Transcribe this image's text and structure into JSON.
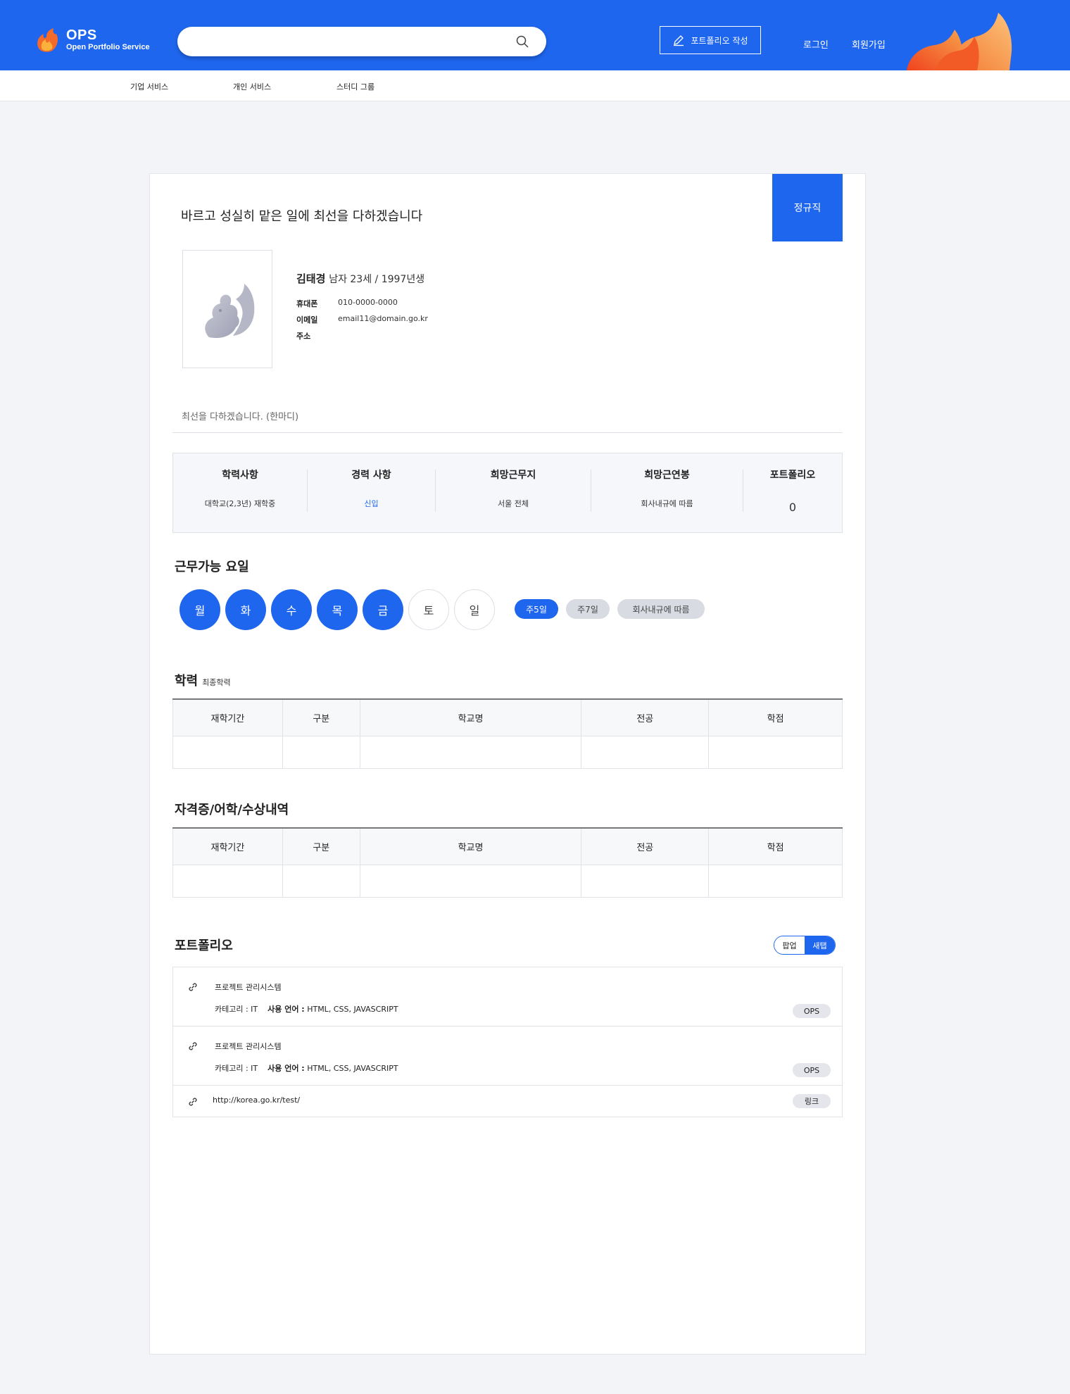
{
  "header": {
    "logo_title": "OPS",
    "logo_subtitle": "Open Portfolio Service",
    "search_placeholder": "",
    "write_button": "포트폴리오 작성",
    "login": "로그인",
    "signup": "회원가입",
    "brand_color": "#1f66ef"
  },
  "subnav": [
    "기업 서비스",
    "개인 서비스",
    "스터디 그룹"
  ],
  "profile": {
    "headline": "바르고 성실히 맡은 일에 최선을 다하겠습니다",
    "employment_type": "정규직",
    "name": "김태경",
    "meta": "남자 23세 / 1997년생",
    "phone_label": "휴대폰",
    "phone": "010-0000-0000",
    "email_label": "이메일",
    "email": "email11@domain.go.kr",
    "address_label": "주소",
    "address": "",
    "greeting": "최선을 다하겠습니다. (한마디)"
  },
  "summary": [
    {
      "title": "학력사항",
      "value": "대학교(2,3년) 재학중"
    },
    {
      "title": "경력 사항",
      "value": "신입"
    },
    {
      "title": "희망근무지",
      "value": "서울 전체"
    },
    {
      "title": "희망근연봉",
      "value": "회사내규에 따름"
    },
    {
      "title": "포트폴리오",
      "value": "0"
    }
  ],
  "workdays": {
    "title": "근무가능 요일",
    "days": [
      {
        "label": "월",
        "selected": true
      },
      {
        "label": "화",
        "selected": true
      },
      {
        "label": "수",
        "selected": true
      },
      {
        "label": "목",
        "selected": true
      },
      {
        "label": "금",
        "selected": true
      },
      {
        "label": "토",
        "selected": false
      },
      {
        "label": "일",
        "selected": false
      }
    ],
    "options": [
      {
        "label": "주5일",
        "selected": true
      },
      {
        "label": "주7일",
        "selected": false
      },
      {
        "label": "회사내규에 따름",
        "selected": false
      }
    ]
  },
  "education": {
    "title": "학력",
    "subtitle": "최종학력",
    "columns": [
      "재학기간",
      "구분",
      "학교명",
      "전공",
      "학점"
    ]
  },
  "certificates": {
    "title": "자격증/어학/수상내역",
    "columns": [
      "재학기간",
      "구분",
      "학교명",
      "전공",
      "학점"
    ]
  },
  "portfolio": {
    "title": "포트폴리오",
    "toggle_popup": "팝업",
    "toggle_newtab": "새탭",
    "items": [
      {
        "title": "프로젝트 관리시스템",
        "category": "카테고리 : IT",
        "lang_label": "사용 언어 :",
        "lang": "HTML, CSS, JAVASCRIPT",
        "tag": "OPS"
      },
      {
        "title": "프로젝트 관리시스템",
        "category": "카테고리 : IT",
        "lang_label": "사용 언어 :",
        "lang": "HTML, CSS, JAVASCRIPT",
        "tag": "OPS"
      }
    ],
    "link_item": {
      "url": "http://korea.go.kr/test/",
      "tag": "링크"
    }
  }
}
